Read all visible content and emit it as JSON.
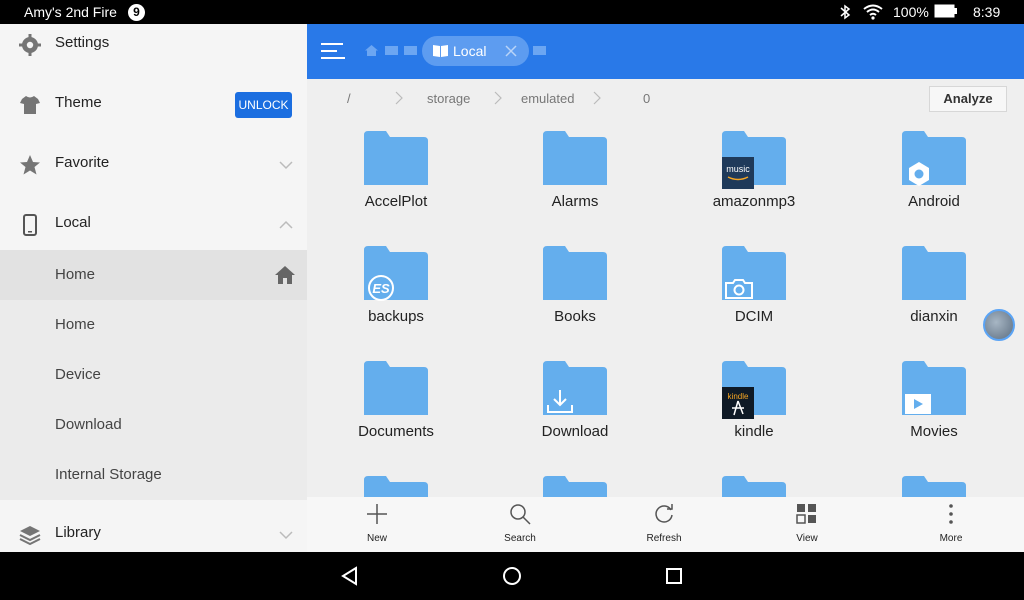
{
  "status_bar": {
    "device_name": "Amy's 2nd Fire",
    "notification_count": "9",
    "battery": "100%",
    "time": "8:39"
  },
  "sidebar": {
    "settings": "Settings",
    "theme": "Theme",
    "unlock": "UNLOCK",
    "favorite": "Favorite",
    "local": "Local",
    "local_items": [
      "Home",
      "Home",
      "Device",
      "Download",
      "Internal Storage"
    ],
    "library": "Library"
  },
  "header": {
    "tab_label": "Local"
  },
  "path": {
    "segments": [
      "/",
      "storage",
      "emulated",
      "0"
    ],
    "analyze": "Analyze"
  },
  "files": [
    {
      "name": "AccelPlot",
      "overlay": "none"
    },
    {
      "name": "Alarms",
      "overlay": "none"
    },
    {
      "name": "amazonmp3",
      "overlay": "music-app-icon",
      "overlay_text": "music"
    },
    {
      "name": "Android",
      "overlay": "gear-icon"
    },
    {
      "name": "backups",
      "overlay": "es-logo-icon",
      "overlay_text": "ES"
    },
    {
      "name": "Books",
      "overlay": "none"
    },
    {
      "name": "DCIM",
      "overlay": "camera-icon"
    },
    {
      "name": "dianxin",
      "overlay": "none"
    },
    {
      "name": "Documents",
      "overlay": "none"
    },
    {
      "name": "Download",
      "overlay": "download-icon"
    },
    {
      "name": "kindle",
      "overlay": "kindle-app-icon",
      "overlay_text": "kindle"
    },
    {
      "name": "Movies",
      "overlay": "play-icon"
    }
  ],
  "toolbar": {
    "new": "New",
    "search": "Search",
    "refresh": "Refresh",
    "view": "View",
    "more": "More"
  },
  "colors": {
    "accent": "#2979e8",
    "folder": "#64aeed",
    "unlock": "#1b6ee0"
  }
}
